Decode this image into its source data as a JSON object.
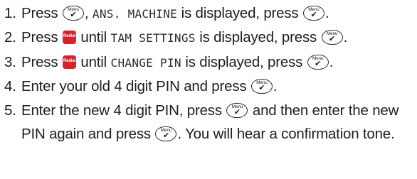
{
  "keys": {
    "menu_label": "Menu",
    "menu_symbol": "✔",
    "redial_label": "Redial",
    "menu_icon": "menu-check-key-icon",
    "redial_icon": "redial-key-icon",
    "redial_color": "#d4232a"
  },
  "steps": [
    {
      "number": "1.",
      "t1": "Press",
      "lcd1": "ANS. MACHINE",
      "t2": "is displayed, press",
      "t3": "."
    },
    {
      "number": "2.",
      "t1": "Press",
      "t2": "until",
      "lcd1": "TAM SETTINGS",
      "t3": "is displayed, press",
      "t4": "."
    },
    {
      "number": "3.",
      "t1": "Press",
      "t2": "until",
      "lcd1": "CHANGE PIN",
      "t3": "is displayed, press",
      "t4": "."
    },
    {
      "number": "4.",
      "t1": "Enter your old 4 digit PIN and press",
      "t2": "."
    },
    {
      "number": "5.",
      "t1": "Enter the new 4 digit PIN, press",
      "t2": "and then enter the new PIN again and press",
      "t3": ". You will hear a confirmation tone."
    }
  ]
}
